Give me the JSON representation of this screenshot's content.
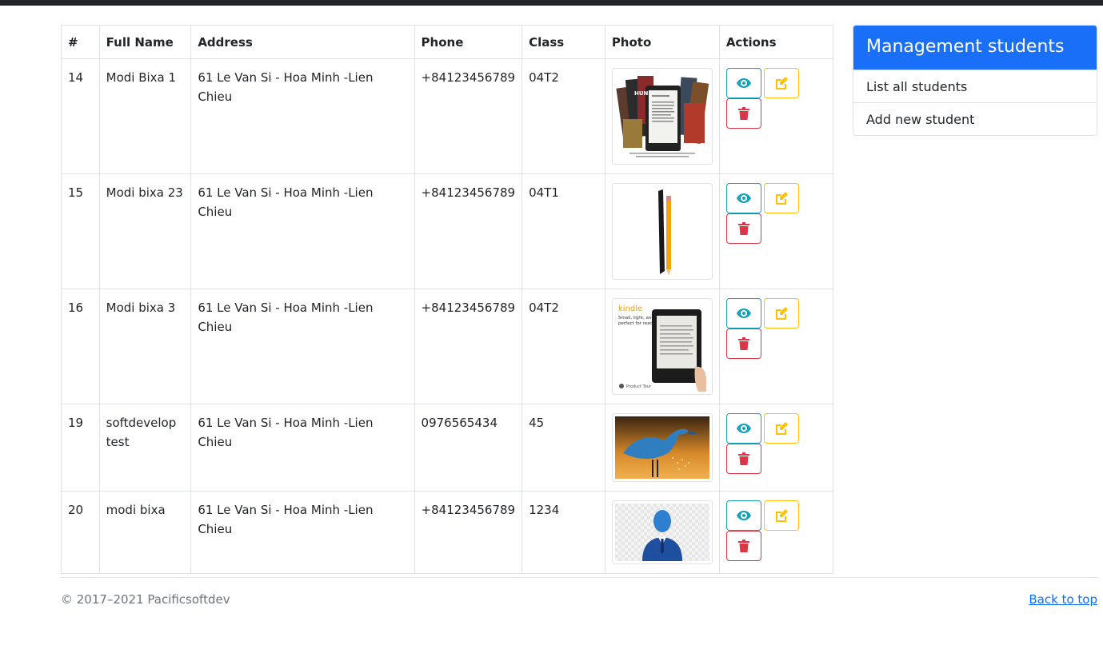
{
  "table": {
    "headers": [
      "#",
      "Full Name",
      "Address",
      "Phone",
      "Class",
      "Photo",
      "Actions"
    ],
    "rows": [
      {
        "id": "14",
        "name": "Modi Bixa 1",
        "address": "61 Le Van Si - Hoa Minh -Lien Chieu",
        "phone": "+84123456789",
        "class": "04T2",
        "photo": "ebook-collection-photo"
      },
      {
        "id": "15",
        "name": "Modi bixa 23",
        "address": "61 Le Van Si - Hoa Minh -Lien Chieu",
        "phone": "+84123456789",
        "class": "04T1",
        "photo": "ereader-pencil-photo"
      },
      {
        "id": "16",
        "name": "Modi bixa 3",
        "address": "61 Le Van Si - Hoa Minh -Lien Chieu",
        "phone": "+84123456789",
        "class": "04T2",
        "photo": "kindle-ad-photo",
        "photo_text": {
          "brand": "kindle",
          "tagline1": "Small, light, and",
          "tagline2": "perfect for reading",
          "tour": "Product Tour"
        }
      },
      {
        "id": "19",
        "name": "softdevelop test",
        "address": "61 Le Van Si - Hoa Minh -Lien Chieu",
        "phone": "0976565434",
        "class": "45",
        "photo": "blue-heron-photo"
      },
      {
        "id": "20",
        "name": "modi bixa",
        "address": "61 Le Van Si - Hoa Minh -Lien Chieu",
        "phone": "+84123456789",
        "class": "1234",
        "photo": "user-avatar-photo"
      }
    ],
    "actions": {
      "view_icon": "eye-icon",
      "edit_icon": "edit-icon",
      "delete_icon": "trash-icon"
    }
  },
  "sidebar": {
    "title": "Management students",
    "items": [
      {
        "label": "List all students"
      },
      {
        "label": "Add new student"
      }
    ]
  },
  "footer": {
    "copyright": "© 2017–2021 Pacificsoftdev",
    "back_to_top": "Back to top"
  },
  "colors": {
    "primary": "#1a6ff9",
    "info": "#17a2b8",
    "warning": "#ffc107",
    "danger": "#dc3545",
    "topbar": "#212529"
  }
}
